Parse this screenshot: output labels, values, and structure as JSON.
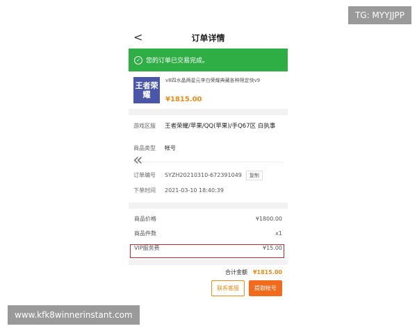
{
  "nav": {
    "back_icon": "<",
    "title": "订单详情"
  },
  "banner": {
    "text": "您的订单已交易完成。",
    "color": "#2fae45"
  },
  "product": {
    "thumb_text": "王者荣耀",
    "name": "v8四水晶两星元李白荣耀典藏各种限定快v9",
    "price": "¥1815.00"
  },
  "details": [
    {
      "label": "游戏区服",
      "value": "王者荣耀/苹果/QQ(苹果)/手Q67区 白执事"
    },
    {
      "label": "商品类型",
      "value": "帐号"
    },
    {
      "label": "订单编号",
      "value": "SYZH20210310-672391049",
      "action": "复制"
    },
    {
      "label": "下单时间",
      "value": "2021-03-10 18:40:39"
    }
  ],
  "summary": [
    {
      "label": "商品价格",
      "value": "¥1800.00"
    },
    {
      "label": "商品件数",
      "value": "x1"
    },
    {
      "label": "VIP服务费",
      "value": "¥15.00"
    }
  ],
  "total": {
    "label": "合计金额",
    "value": "¥1815.00"
  },
  "buttons": {
    "contact": "联系客服",
    "retrieve": "提取帐号"
  },
  "overlays": {
    "top_right": "TG: MYYJJPP",
    "bottom_left": "www.kfk8winnerinstant.com"
  },
  "colors": {
    "accent": "#f08a16",
    "highlight_border": "#c0262e"
  }
}
